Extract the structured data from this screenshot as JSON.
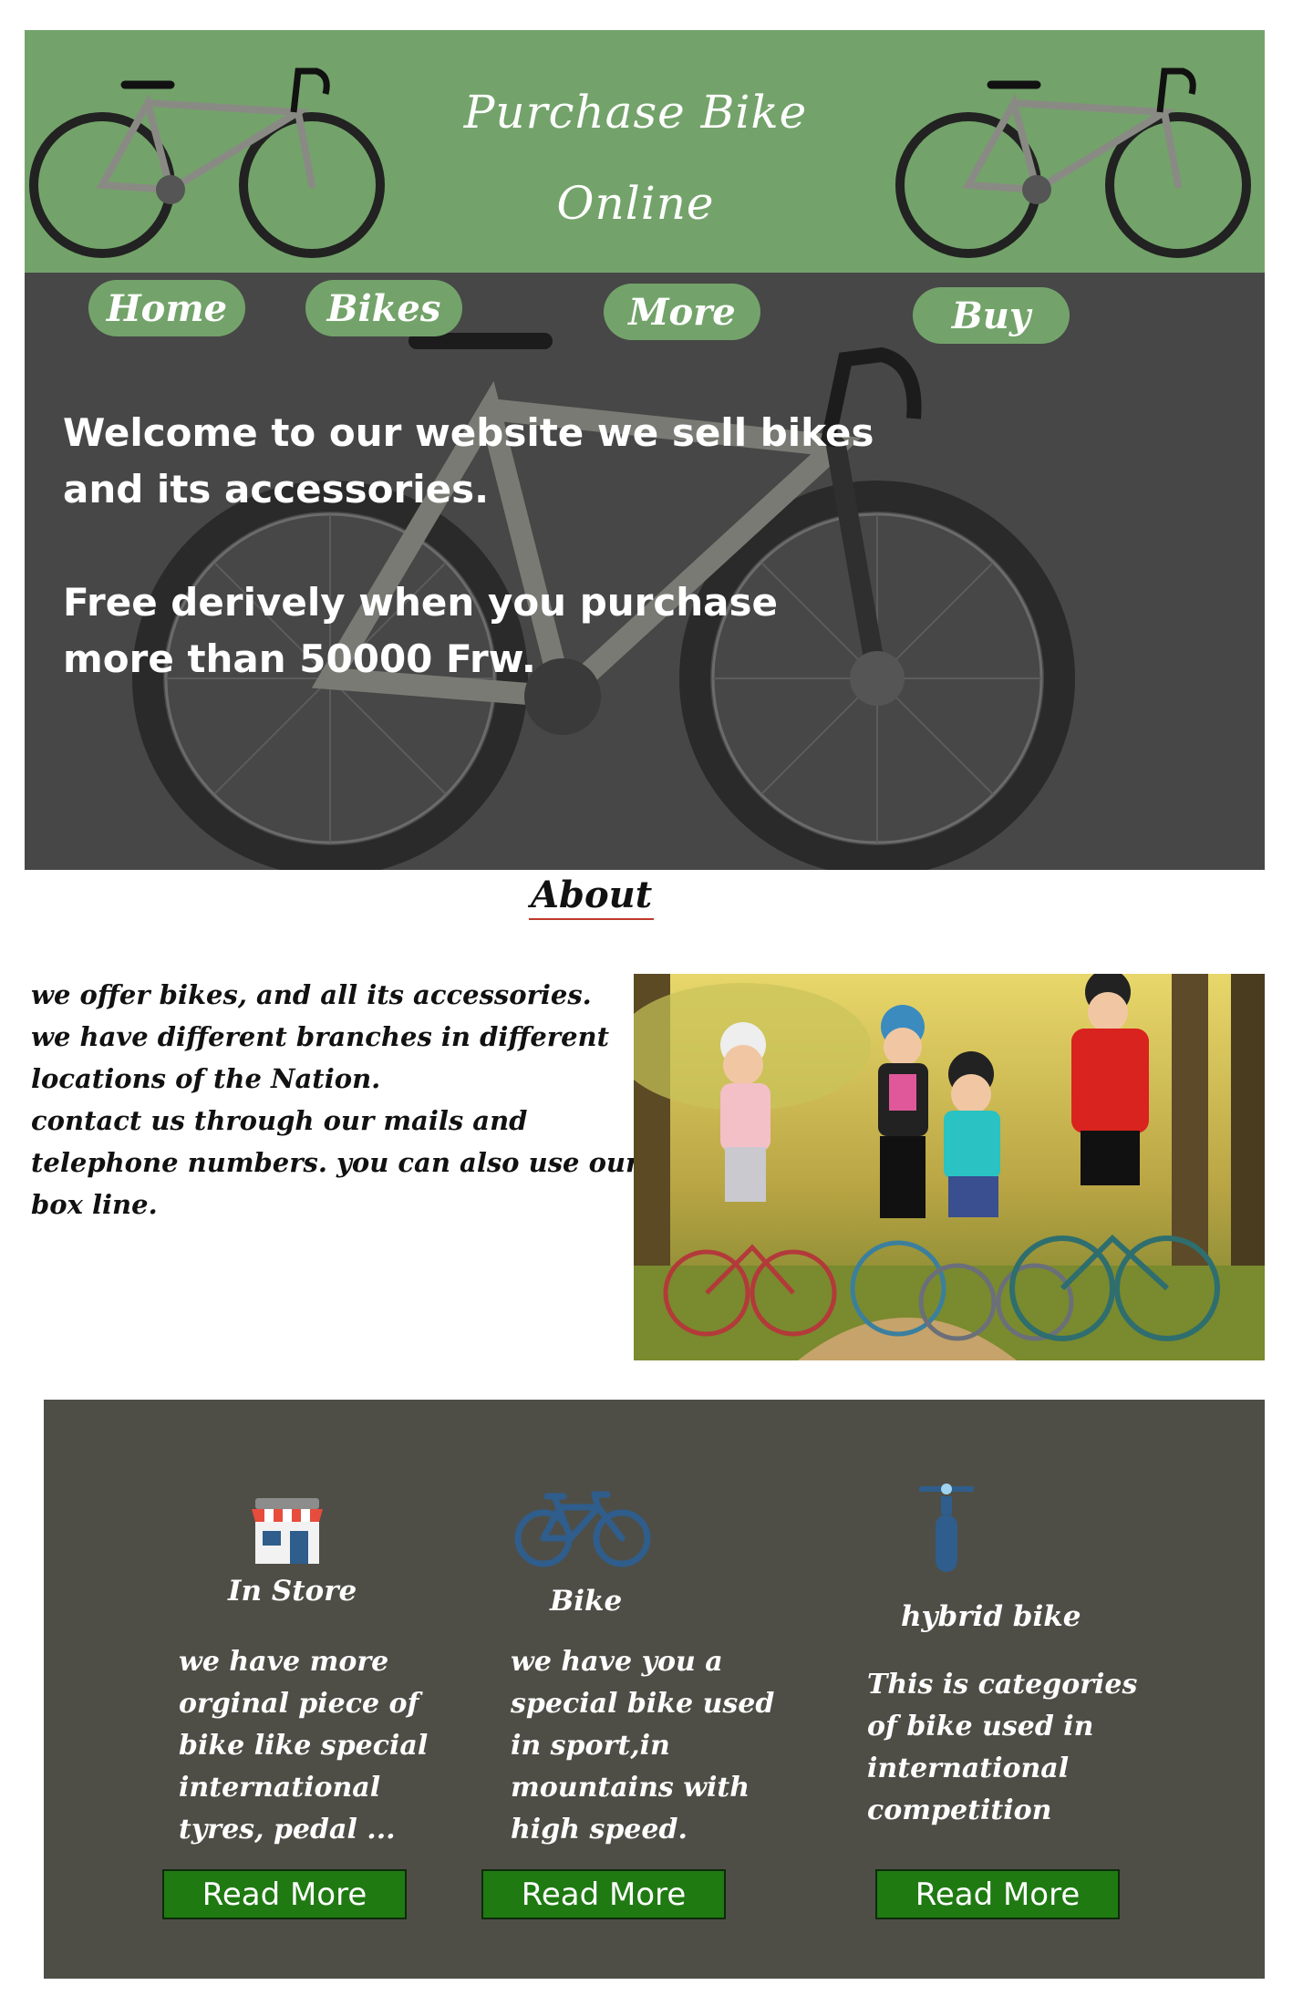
{
  "header": {
    "title_line1": "Purchase Bike",
    "title_line2": "Online",
    "bg_color": "#73a36a"
  },
  "nav": {
    "items": [
      {
        "label": "Home"
      },
      {
        "label": "Bikes"
      },
      {
        "label": "More"
      },
      {
        "label": "Buy"
      }
    ]
  },
  "hero": {
    "line1": "Welcome to our website we sell bikes",
    "line2": "and its accessories.",
    "line3": "Free derively when you purchase",
    "line4": "more than 50000 Frw.",
    "bg_color": "#474747"
  },
  "about": {
    "title": "About",
    "lines": [
      "we offer bikes, and all its accessories.",
      "we have different branches in different",
      "locations of the Nation.",
      "contact us through our mails and",
      "telephone numbers. you can also use our",
      "box line."
    ]
  },
  "features": {
    "bg_color": "#4e4e47",
    "button_color": "#1f7a12",
    "items": [
      {
        "icon": "store-icon",
        "title": "In Store",
        "desc": [
          "we have more",
          "orginal piece of",
          "bike like special",
          "international",
          "tyres, pedal ..."
        ],
        "button": "Read More"
      },
      {
        "icon": "bicycle-icon",
        "title": "Bike",
        "desc": [
          "we have you a",
          "special bike used",
          "in sport,in",
          "mountains with",
          "high speed."
        ],
        "button": "Read More"
      },
      {
        "icon": "hybrid-bike-icon",
        "title": "hybrid bike",
        "desc": [
          "This is categories",
          "of bike used in",
          "international",
          "competition"
        ],
        "button": "Read More"
      }
    ]
  }
}
